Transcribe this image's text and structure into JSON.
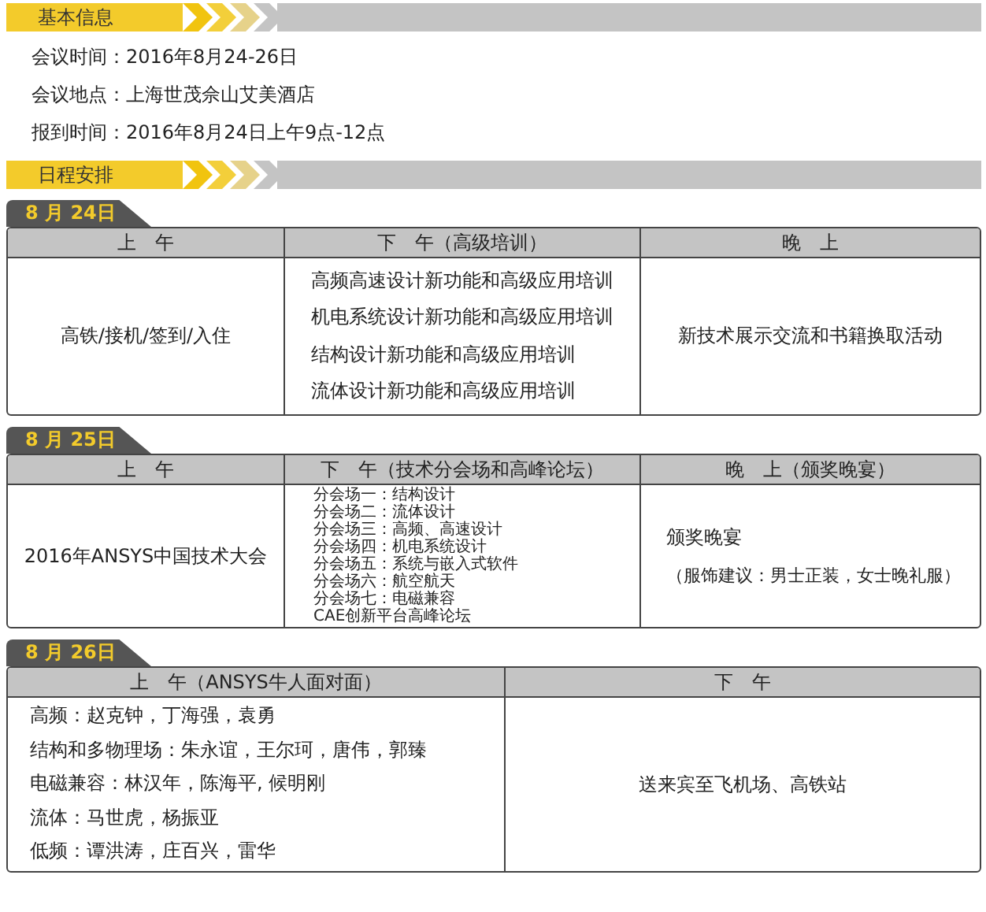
{
  "basic_info": {
    "title": "基本信息",
    "lines": [
      "会议时间：2016年8月24-26日",
      "会议地点：上海世茂佘山艾美酒店",
      "报到时间：2016年8月24日上午9点-12点"
    ]
  },
  "schedule": {
    "title": "日程安排",
    "days": [
      {
        "date": "8 月 24日",
        "cells": [
          {
            "heading": "上　午",
            "kind": "centered",
            "lines": [
              "高铁/接机/签到/入住"
            ]
          },
          {
            "heading": "下　午（高级培训）",
            "kind": "list",
            "lines": [
              "高频高速设计新功能和高级应用培训",
              "机电系统设计新功能和高级应用培训",
              "结构设计新功能和高级应用培训",
              "流体设计新功能和高级应用培训"
            ]
          },
          {
            "heading": "晚　上",
            "kind": "centered",
            "lines": [
              "新技术展示交流和书籍换取活动"
            ]
          }
        ]
      },
      {
        "date": "8 月 25日",
        "cells": [
          {
            "heading": "上　午",
            "kind": "centered",
            "lines": [
              "2016年ANSYS中国技术大会"
            ]
          },
          {
            "heading": "下　午（技术分会场和高峰论坛）",
            "kind": "compact",
            "lines": [
              "分会场一：结构设计",
              "分会场二：流体设计",
              "分会场三：高频、高速设计",
              "分会场四：机电系统设计",
              "分会场五：系统与嵌入式软件",
              "分会场六：航空航天",
              "分会场七：电磁兼容",
              "CAE创新平台高峰论坛"
            ]
          },
          {
            "heading": "晚　上（颁奖晚宴）",
            "kind": "remark",
            "lines": [
              "颁奖晚宴",
              "（服饰建议：男士正装，女士晚礼服）"
            ]
          }
        ]
      },
      {
        "date": "8 月 26日",
        "cells": [
          {
            "heading": "上　午（ANSYS牛人面对面）",
            "kind": "roster",
            "lines": [
              "高频：赵克钟，丁海强，袁勇",
              "结构和多物理场：朱永谊，王尔珂，唐伟，郭臻",
              "电磁兼容：林汉年，陈海平, 候明刚",
              "流体：马世虎，杨振亚",
              "低频：谭洪涛，庄百兴，雷华"
            ]
          },
          {
            "heading": "下　午",
            "kind": "centered",
            "lines": [
              "送来宾至飞机场、高铁站"
            ]
          }
        ]
      }
    ]
  }
}
